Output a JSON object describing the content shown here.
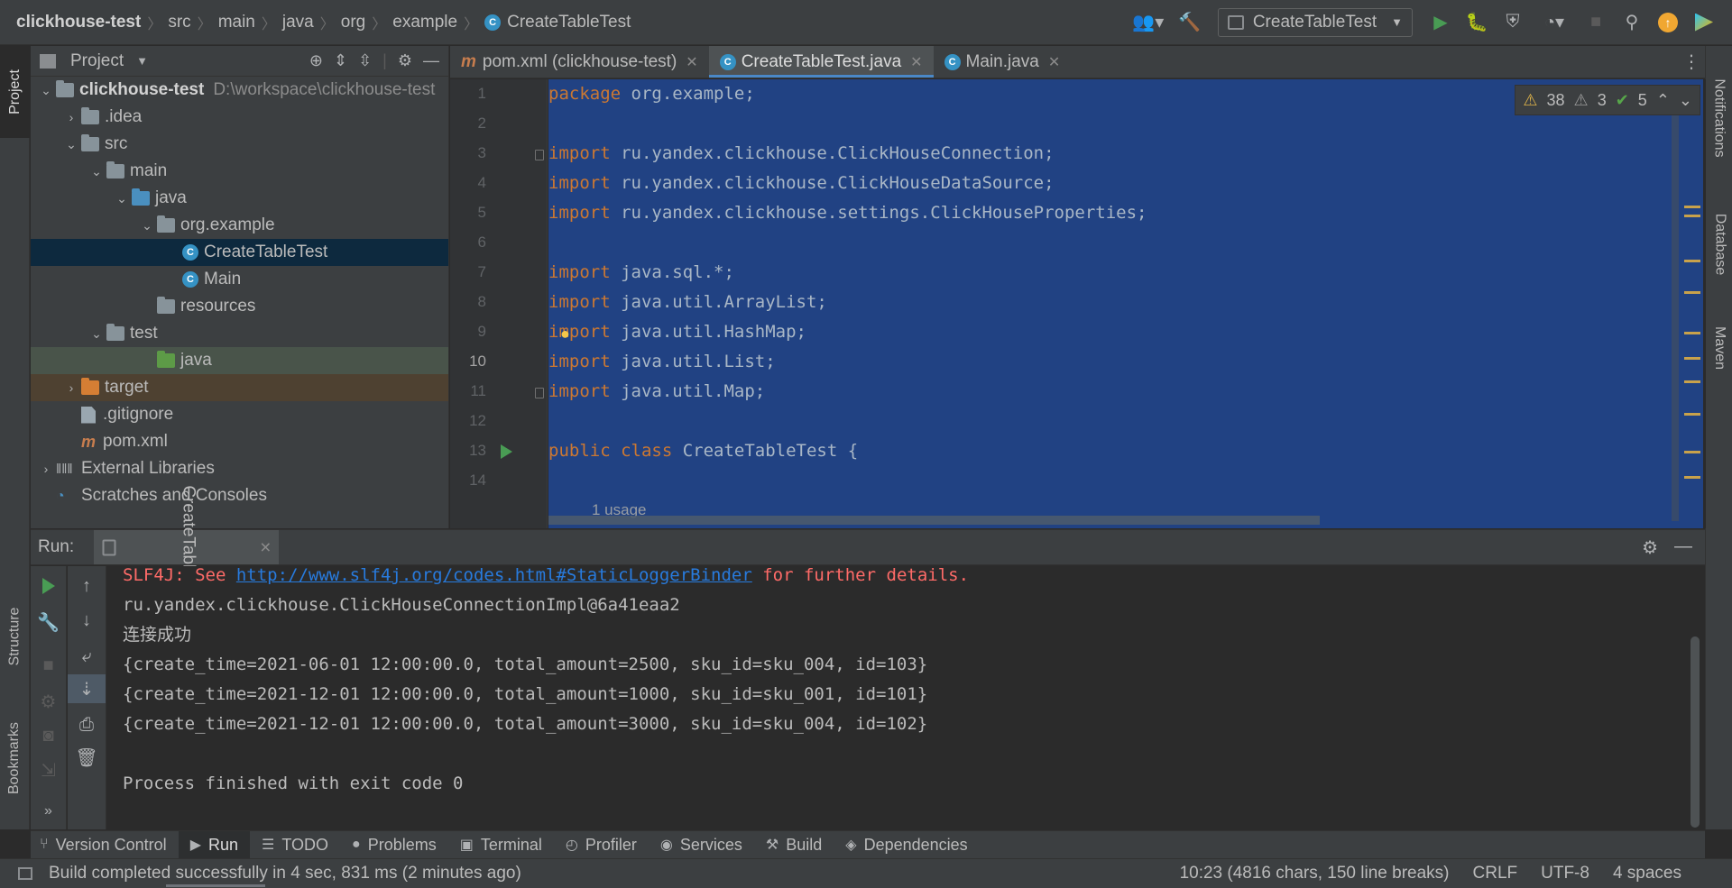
{
  "breadcrumbs": [
    "clickhouse-test",
    "src",
    "main",
    "java",
    "org",
    "example",
    "CreateTableTest"
  ],
  "toolbar": {
    "run_config": "CreateTableTest"
  },
  "left_stripe": {
    "project": "Project",
    "structure": "Structure",
    "bookmarks": "Bookmarks"
  },
  "right_stripe": {
    "notifications": "Notifications",
    "database": "Database",
    "maven": "Maven"
  },
  "project_panel": {
    "title": "Project",
    "tree": [
      {
        "label": "clickhouse-test",
        "extra": "D:\\workspace\\clickhouse-test"
      },
      {
        "label": ".idea"
      },
      {
        "label": "src"
      },
      {
        "label": "main"
      },
      {
        "label": "java"
      },
      {
        "label": "org.example"
      },
      {
        "label": "CreateTableTest"
      },
      {
        "label": "Main"
      },
      {
        "label": "resources"
      },
      {
        "label": "test"
      },
      {
        "label": "java"
      },
      {
        "label": "target"
      },
      {
        "label": ".gitignore"
      },
      {
        "label": "pom.xml"
      },
      {
        "label": "External Libraries"
      },
      {
        "label": "Scratches and Consoles"
      }
    ]
  },
  "editor": {
    "tabs": [
      {
        "label": "pom.xml (clickhouse-test)"
      },
      {
        "label": "CreateTableTest.java"
      },
      {
        "label": "Main.java"
      }
    ],
    "line_numbers": [
      "1",
      "2",
      "3",
      "4",
      "5",
      "6",
      "7",
      "8",
      "9",
      "10",
      "11",
      "12",
      "13",
      "14"
    ],
    "lines": [
      {
        "kw": "package",
        "rest": " org.example;"
      },
      {
        "kw": "",
        "rest": ""
      },
      {
        "kw": "import",
        "rest": " ru.yandex.clickhouse.ClickHouseConnection;"
      },
      {
        "kw": "import",
        "rest": " ru.yandex.clickhouse.ClickHouseDataSource;"
      },
      {
        "kw": "import",
        "rest": " ru.yandex.clickhouse.settings.ClickHouseProperties;"
      },
      {
        "kw": "",
        "rest": ""
      },
      {
        "kw": "import",
        "rest": " java.sql.*;"
      },
      {
        "kw": "import",
        "rest": " java.util.ArrayList;"
      },
      {
        "kw": "import",
        "rest": " java.util.HashMap;"
      },
      {
        "kw": "import",
        "rest": " java.util.List;"
      },
      {
        "kw": "import",
        "rest": " java.util.Map;"
      },
      {
        "kw": "",
        "rest": ""
      },
      {
        "kw": "public class",
        "rest": " CreateTableTest {"
      },
      {
        "kw": "",
        "rest": ""
      }
    ],
    "usage_hint": "1 usage",
    "inspections": {
      "warnings": "38",
      "weak_warnings": "3",
      "typos": "5"
    }
  },
  "run_panel": {
    "label": "Run:",
    "tab": "CreateTableTest",
    "console": {
      "slf4j_prefix": "SLF4J: See ",
      "slf4j_link": "http://www.slf4j.org/codes.html#StaticLoggerBinder",
      "slf4j_suffix": " for further details.",
      "lines": [
        "ru.yandex.clickhouse.ClickHouseConnectionImpl@6a41eaa2",
        "连接成功",
        "{create_time=2021-06-01 12:00:00.0, total_amount=2500, sku_id=sku_004, id=103}",
        "{create_time=2021-12-01 12:00:00.0, total_amount=1000, sku_id=sku_001, id=101}",
        "{create_time=2021-12-01 12:00:00.0, total_amount=3000, sku_id=sku_004, id=102}",
        "",
        "Process finished with exit code 0"
      ]
    }
  },
  "tool_tabs": [
    {
      "label": "Version Control"
    },
    {
      "label": "Run"
    },
    {
      "label": "TODO"
    },
    {
      "label": "Problems"
    },
    {
      "label": "Terminal"
    },
    {
      "label": "Profiler"
    },
    {
      "label": "Services"
    },
    {
      "label": "Build"
    },
    {
      "label": "Dependencies"
    }
  ],
  "status_bar": {
    "message": "Build completed successfully in 4 sec, 831 ms (2 minutes ago)",
    "position": "10:23 (4816 chars, 150 line breaks)",
    "line_sep": "CRLF",
    "encoding": "UTF-8",
    "indent": "4 spaces"
  },
  "colors": {
    "keyword": "#cc7832",
    "selection": "#214283",
    "error_text": "#ff6b68",
    "link": "#287bde"
  }
}
